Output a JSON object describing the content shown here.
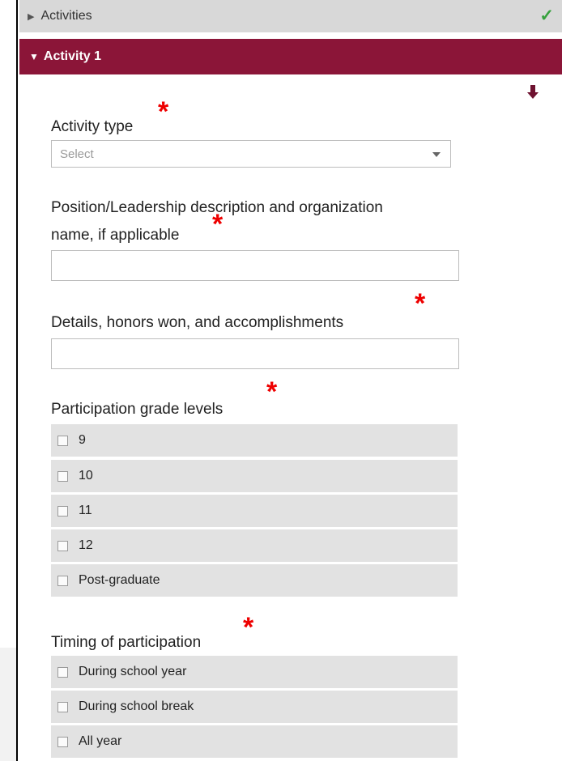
{
  "section": {
    "label": "Activities",
    "complete_icon": "checkmark-icon"
  },
  "activity": {
    "label": "Activity 1",
    "move_icon": "arrow-down-icon"
  },
  "required_marker": "*",
  "activity_type": {
    "label": "Activity type",
    "value": "Select"
  },
  "position": {
    "label_line1": "Position/Leadership description and organization",
    "label_line2": "name, if applicable",
    "value": ""
  },
  "details": {
    "label": "Details, honors won, and accomplishments",
    "value": ""
  },
  "grade_levels": {
    "label": "Participation grade levels",
    "options": [
      "9",
      "10",
      "11",
      "12",
      "Post-graduate"
    ]
  },
  "timing": {
    "label": "Timing of participation",
    "options": [
      "During school year",
      "During school break",
      "All year"
    ]
  },
  "colors": {
    "header_accent": "#8b1538",
    "required": "#ee0000",
    "complete": "#35a13c"
  }
}
